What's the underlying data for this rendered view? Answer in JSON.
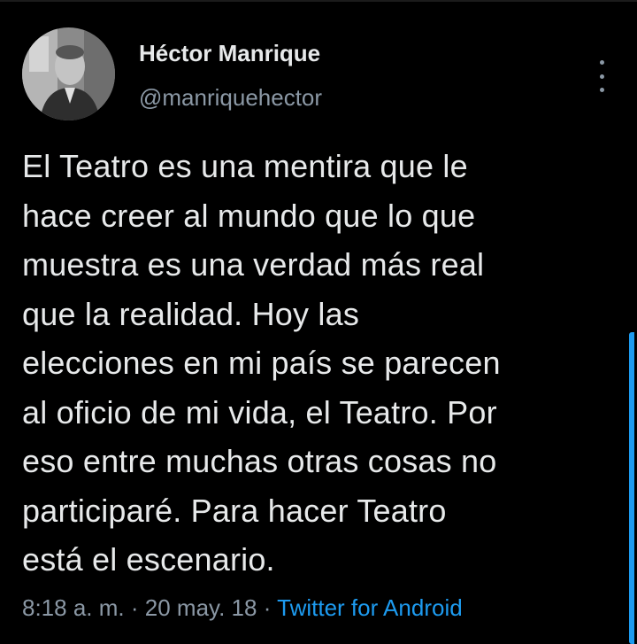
{
  "author": {
    "name": "Héctor Manrique",
    "handle": "@manriquehector",
    "avatar_icon": "profile-photo"
  },
  "tweet": {
    "text_lines": [
      "El Teatro es una mentira que le",
      "hace creer al mundo que lo que",
      "muestra es una verdad más real",
      "que la realidad. Hoy las",
      "elecciones en mi país se parecen",
      "al oficio de mi vida, el Teatro. Por",
      "eso entre muchas otras cosas no",
      "participaré. Para hacer Teatro",
      "está el escenario."
    ]
  },
  "meta": {
    "time": "8:18 a. m.",
    "separator": "·",
    "date": "20 may. 18",
    "source": "Twitter for Android"
  },
  "icons": {
    "more": "more-vertical-icon"
  },
  "colors": {
    "background": "#000000",
    "text": "#e7e9ea",
    "secondary": "#8b98a5",
    "accent": "#1d9bf0"
  }
}
